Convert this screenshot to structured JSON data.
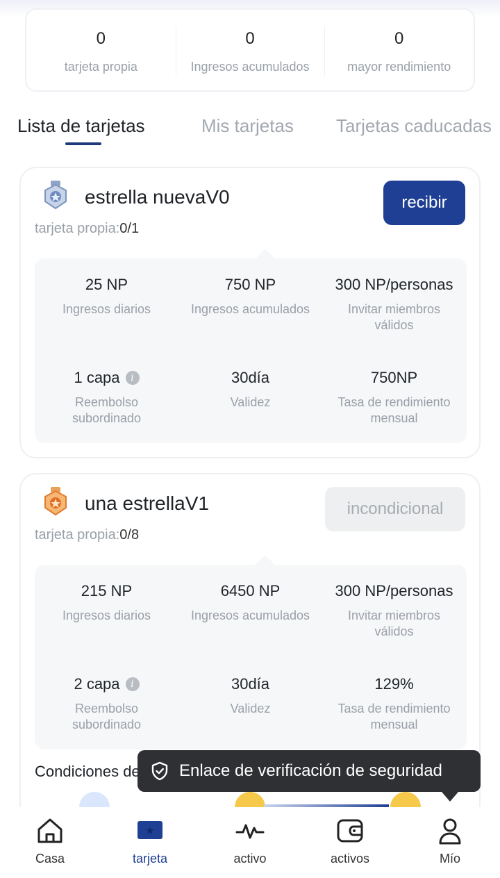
{
  "stats": [
    {
      "value": "0",
      "label": "tarjeta propia"
    },
    {
      "value": "0",
      "label": "Ingresos acumulados"
    },
    {
      "value": "0",
      "label": "mayor rendimiento"
    }
  ],
  "tabs": [
    {
      "label": "Lista de tarjetas",
      "active": true
    },
    {
      "label": "Mis tarjetas",
      "active": false
    },
    {
      "label": "Tarjetas caducadas",
      "active": false
    }
  ],
  "cards": [
    {
      "title": "estrella nuevaV0",
      "owned_label": "tarjeta propia:",
      "owned_value": "0/1",
      "button": "recibir",
      "button_state": "enabled",
      "icon": "silver-medal-icon",
      "details": [
        {
          "value": "25 NP",
          "label": "Ingresos diarios"
        },
        {
          "value": "750 NP",
          "label": "Ingresos acumulados"
        },
        {
          "value": "300 NP/personas",
          "label": "Invitar miembros válidos"
        },
        {
          "value": "1 capa",
          "label": "Reembolso subordinado",
          "info": true
        },
        {
          "value": "30día",
          "label": "Validez"
        },
        {
          "value": "750NP",
          "label": "Tasa de rendimiento mensual"
        }
      ]
    },
    {
      "title": "una estrellaV1",
      "owned_label": "tarjeta propia:",
      "owned_value": "0/8",
      "button": "incondicional",
      "button_state": "disabled",
      "icon": "bronze-medal-icon",
      "details": [
        {
          "value": "215 NP",
          "label": "Ingresos diarios"
        },
        {
          "value": "6450 NP",
          "label": "Ingresos acumulados"
        },
        {
          "value": "300 NP/personas",
          "label": "Invitar miembros válidos"
        },
        {
          "value": "2 capa",
          "label": "Reembolso subordinado",
          "info": true
        },
        {
          "value": "30día",
          "label": "Validez"
        },
        {
          "value": "129%",
          "label": "Tasa de rendimiento mensual"
        }
      ]
    }
  ],
  "conditions_label": "Condiciones de",
  "toast": {
    "text": "Enlace de verificación de seguridad",
    "icon": "shield-check-icon"
  },
  "nav": [
    {
      "label": "Casa",
      "icon": "home-icon",
      "active": false
    },
    {
      "label": "tarjeta",
      "icon": "card-star-icon",
      "active": true
    },
    {
      "label": "activo",
      "icon": "pulse-icon",
      "active": false
    },
    {
      "label": "activos",
      "icon": "wallet-icon",
      "active": false
    },
    {
      "label": "Mío",
      "icon": "user-icon",
      "active": false
    }
  ],
  "colors": {
    "accent": "#1e3f93",
    "toast_bg": "#2e3034",
    "muted": "#9aa0a8"
  }
}
